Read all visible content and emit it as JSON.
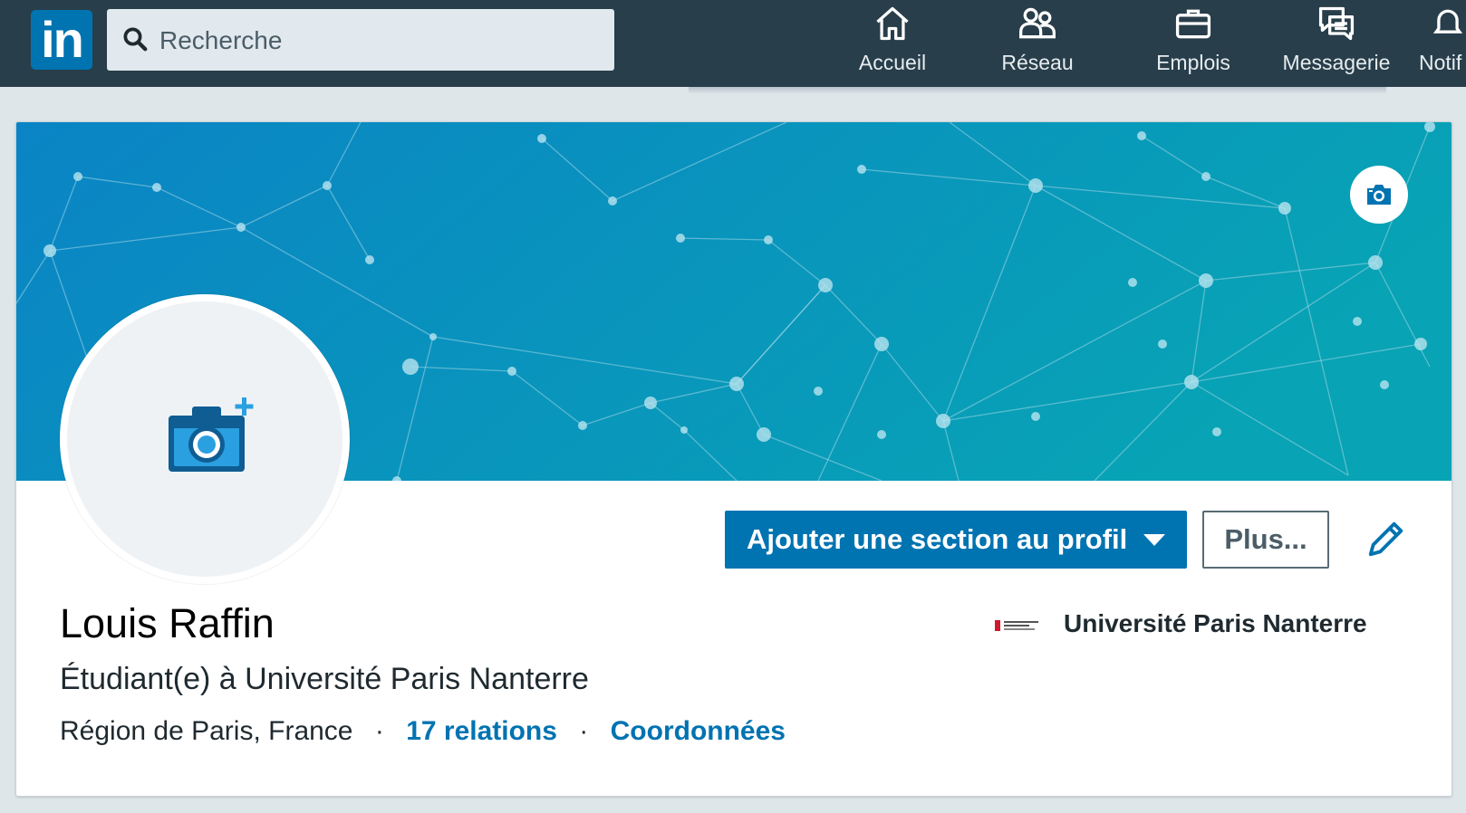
{
  "nav": {
    "logo_text": "in",
    "search_placeholder": "Recherche",
    "items": [
      {
        "label": "Accueil",
        "icon": "home-icon"
      },
      {
        "label": "Réseau",
        "icon": "network-icon"
      },
      {
        "label": "Emplois",
        "icon": "briefcase-icon"
      },
      {
        "label": "Messagerie",
        "icon": "messaging-icon"
      },
      {
        "label": "Notif",
        "icon": "bell-icon"
      }
    ]
  },
  "profile": {
    "add_section_label": "Ajouter une section au profil",
    "more_label": "Plus...",
    "name": "Louis Raffin",
    "headline": "Étudiant(e) à Université Paris Nanterre",
    "location": "Région de Paris, France",
    "separator": "·",
    "connections_label": "17 relations",
    "contact_label": "Coordonnées",
    "school_name": "Université Paris Nanterre"
  },
  "colors": {
    "nav_bg": "#283e4a",
    "brand_blue": "#0073b1",
    "banner_start": "#0a84c5",
    "banner_end": "#08a3b5"
  }
}
